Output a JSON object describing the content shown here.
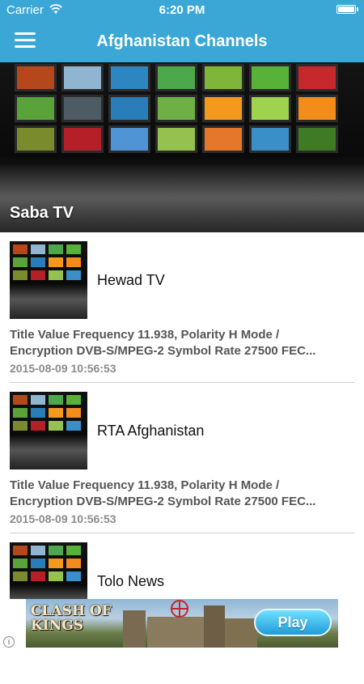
{
  "status_bar": {
    "carrier": "Carrier",
    "time": "6:20 PM"
  },
  "nav": {
    "title": "Afghanistan Channels",
    "menu_icon": "hamburger-menu-icon"
  },
  "hero": {
    "title": "Saba TV"
  },
  "items": [
    {
      "title": "Hewad TV",
      "description": "Title Value Frequency 11.938,  Polarity H Mode /\nEncryption DVB-S/MPEG-2  Symbol Rate   27500 FEC...",
      "date": "2015-08-09 10:56:53"
    },
    {
      "title": "RTA Afghanistan",
      "description": "Title Value Frequency 11.938,  Polarity H Mode /\nEncryption DVB-S/MPEG-2  Symbol Rate   27500 FEC...",
      "date": "2015-08-09 10:56:53"
    },
    {
      "title": "Tolo News",
      "description": "",
      "date": ""
    }
  ],
  "ad": {
    "logo_line1": "CLASH OF",
    "logo_line2": "KINGS",
    "play_label": "Play",
    "info_label": "i"
  },
  "colors": {
    "accent": "#3aa7d6"
  }
}
